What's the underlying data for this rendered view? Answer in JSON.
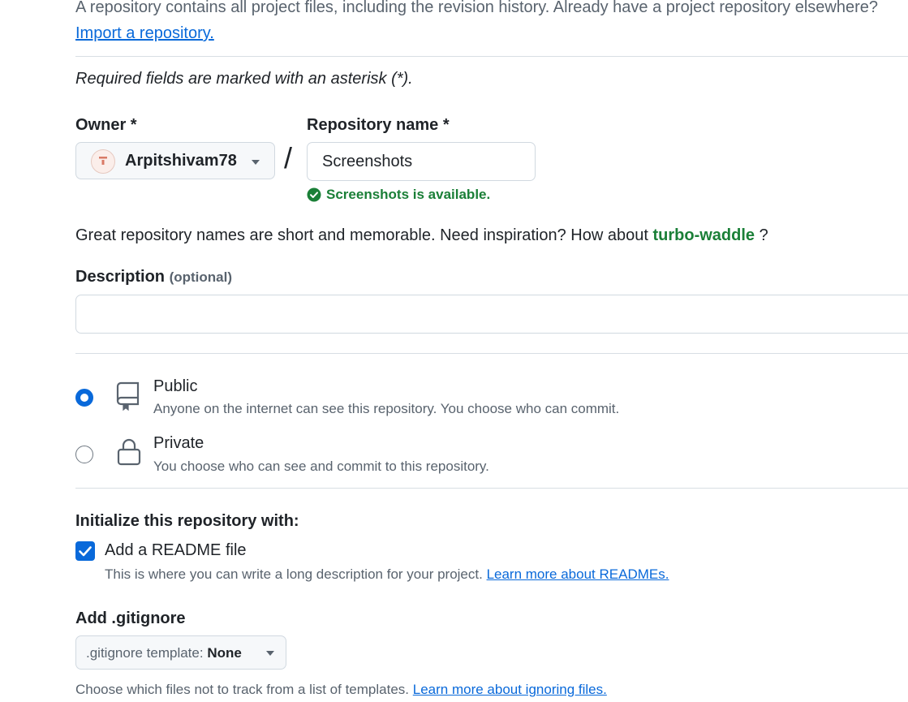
{
  "intro": {
    "text": "A repository contains all project files, including the revision history. Already have a project repository elsewhere?",
    "import_link": "Import a repository."
  },
  "required_note": "Required fields are marked with an asterisk (*).",
  "owner": {
    "label": "Owner *",
    "value": "Arpitshivam78"
  },
  "separator": "/",
  "repo_name": {
    "label": "Repository name *",
    "value": "Screenshots",
    "availability": "Screenshots is available."
  },
  "suggestion": {
    "prefix": "Great repository names are short and memorable. Need inspiration? How about",
    "name": "turbo-waddle",
    "suffix": "?"
  },
  "description": {
    "label": "Description",
    "optional": "(optional)",
    "value": ""
  },
  "visibility": {
    "selected": "public",
    "options": [
      {
        "title": "Public",
        "desc": "Anyone on the internet can see this repository. You choose who can commit.",
        "icon": "repo-icon"
      },
      {
        "title": "Private",
        "desc": "You choose who can see and commit to this repository.",
        "icon": "lock-icon"
      }
    ]
  },
  "initialize": {
    "heading": "Initialize this repository with:",
    "readme_label": "Add a README file",
    "readme_checked": true,
    "readme_desc": "This is where you can write a long description for your project.",
    "readme_link": "Learn more about READMEs."
  },
  "gitignore": {
    "heading": "Add .gitignore",
    "prefix": ".gitignore template:",
    "value": "None",
    "desc": "Choose which files not to track from a list of templates.",
    "link": "Learn more about ignoring files."
  },
  "colors": {
    "accent": "#0969da",
    "success": "#1a7f37",
    "muted": "#59636e",
    "border": "#d1d9e0"
  }
}
